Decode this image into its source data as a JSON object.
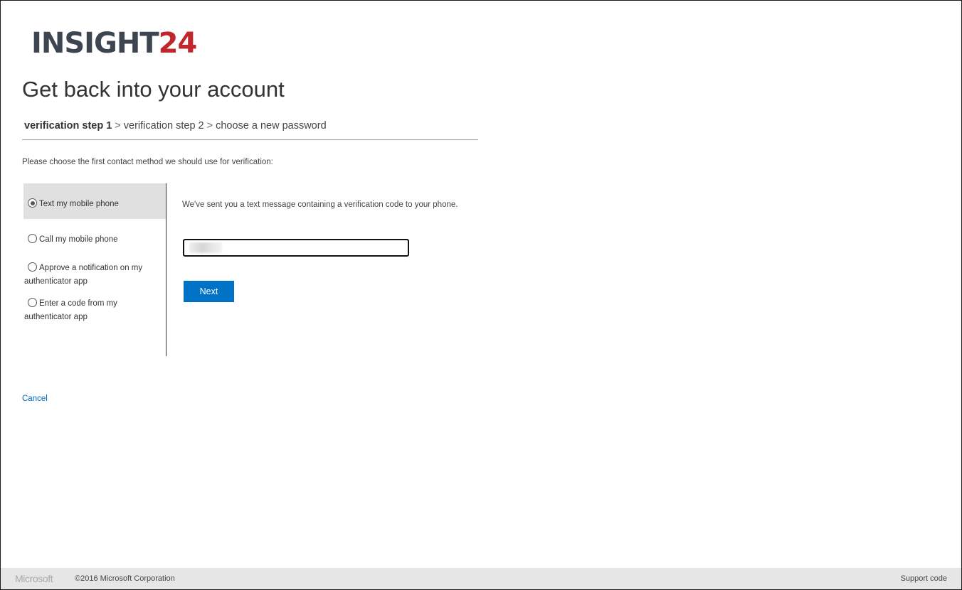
{
  "brand": {
    "logo_main": "INSIGHT",
    "logo_num": "24",
    "logo_main_color": "#3c4550",
    "logo_accent_color": "#c0272d"
  },
  "page": {
    "title": "Get back into your account",
    "instructions": "Please choose the first contact method we should use for verification:"
  },
  "steps": {
    "current": "verification step 1",
    "separator": ">",
    "step2": "verification step 2",
    "step3": "choose a new password"
  },
  "methods": [
    {
      "label": "Text my mobile phone",
      "selected": true
    },
    {
      "label": "Call my mobile phone",
      "selected": false
    },
    {
      "label_line1": "Approve a notification on my",
      "label_line2": "authenticator app",
      "selected": false
    },
    {
      "label_line1": "Enter a code from my",
      "label_line2": "authenticator app",
      "selected": false
    }
  ],
  "verification": {
    "sent_message": "We've sent you a text message containing a verification code to your phone.",
    "code_value": ""
  },
  "actions": {
    "next_label": "Next",
    "cancel_label": "Cancel",
    "primary_color": "#0072c6"
  },
  "footer": {
    "ms_logo": "Microsoft",
    "copyright": "©2016 Microsoft Corporation",
    "support_code": "Support code"
  }
}
